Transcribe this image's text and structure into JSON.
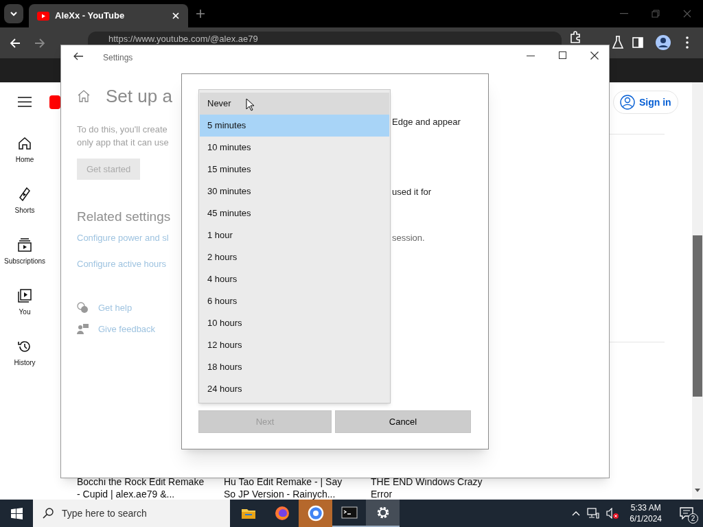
{
  "browser": {
    "tabs": [
      {
        "title": "AleXx - YouTube",
        "selected": true
      }
    ],
    "url": "https://www.youtube.com/@alex.ae79"
  },
  "youtube": {
    "sidebar": [
      {
        "kind": "home",
        "label": "Home"
      },
      {
        "kind": "shorts",
        "label": "Shorts"
      },
      {
        "kind": "subscriptions",
        "label": "Subscriptions"
      },
      {
        "kind": "you",
        "label": "You"
      },
      {
        "kind": "history",
        "label": "History"
      }
    ],
    "sign_in": "Sign in",
    "videos": [
      {
        "lines": [
          "Bocchi the Rock Edit Remake",
          "- Cupid | alex.ae79 &..."
        ]
      },
      {
        "lines": [
          "Hu Tao Edit Remake - | Say",
          "So JP Version - Rainych..."
        ]
      },
      {
        "lines": [
          "THE END Windows Crazy",
          "Error"
        ]
      }
    ]
  },
  "settings": {
    "title": "Settings",
    "heading": "Set up a",
    "description_lines": [
      "To do this, you'll create",
      "only app that it can use"
    ],
    "get_started": {
      "label": "Get started",
      "disabled": true
    },
    "related_heading": "Related settings",
    "links": [
      "Configure power and sl",
      "Configure active hours"
    ],
    "help": [
      {
        "kind": "help",
        "label": "Get help"
      },
      {
        "kind": "feedback",
        "label": "Give feedback"
      }
    ]
  },
  "dialog": {
    "text_fragments": [
      "Edge and appear",
      "used it for",
      "session."
    ],
    "options": [
      {
        "label": "Never",
        "selected": false,
        "hovered": true
      },
      {
        "label": "5 minutes",
        "selected": true,
        "hovered": false
      },
      {
        "label": "10 minutes",
        "selected": false,
        "hovered": false
      },
      {
        "label": "15 minutes",
        "selected": false,
        "hovered": false
      },
      {
        "label": "30 minutes",
        "selected": false,
        "hovered": false
      },
      {
        "label": "45 minutes",
        "selected": false,
        "hovered": false
      },
      {
        "label": "1 hour",
        "selected": false,
        "hovered": false
      },
      {
        "label": "2 hours",
        "selected": false,
        "hovered": false
      },
      {
        "label": "4 hours",
        "selected": false,
        "hovered": false
      },
      {
        "label": "6 hours",
        "selected": false,
        "hovered": false
      },
      {
        "label": "10 hours",
        "selected": false,
        "hovered": false
      },
      {
        "label": "12 hours",
        "selected": false,
        "hovered": false
      },
      {
        "label": "18 hours",
        "selected": false,
        "hovered": false
      },
      {
        "label": "24 hours",
        "selected": false,
        "hovered": false
      }
    ],
    "buttons": [
      {
        "label": "Next",
        "disabled": true
      },
      {
        "label": "Cancel",
        "disabled": false
      }
    ]
  },
  "taskbar": {
    "search_placeholder": "Type here to search",
    "apps": [
      {
        "kind": "explorer",
        "flashing": false,
        "running": false,
        "active": false
      },
      {
        "kind": "firefox",
        "flashing": false,
        "running": false,
        "active": false
      },
      {
        "kind": "chrome",
        "flashing": true,
        "running": false,
        "active": false
      },
      {
        "kind": "terminal",
        "flashing": false,
        "running": true,
        "active": false
      },
      {
        "kind": "settings",
        "flashing": false,
        "running": true,
        "active": true
      }
    ],
    "time": "5:33 AM",
    "date": "6/1/2024",
    "notifications": "2"
  }
}
